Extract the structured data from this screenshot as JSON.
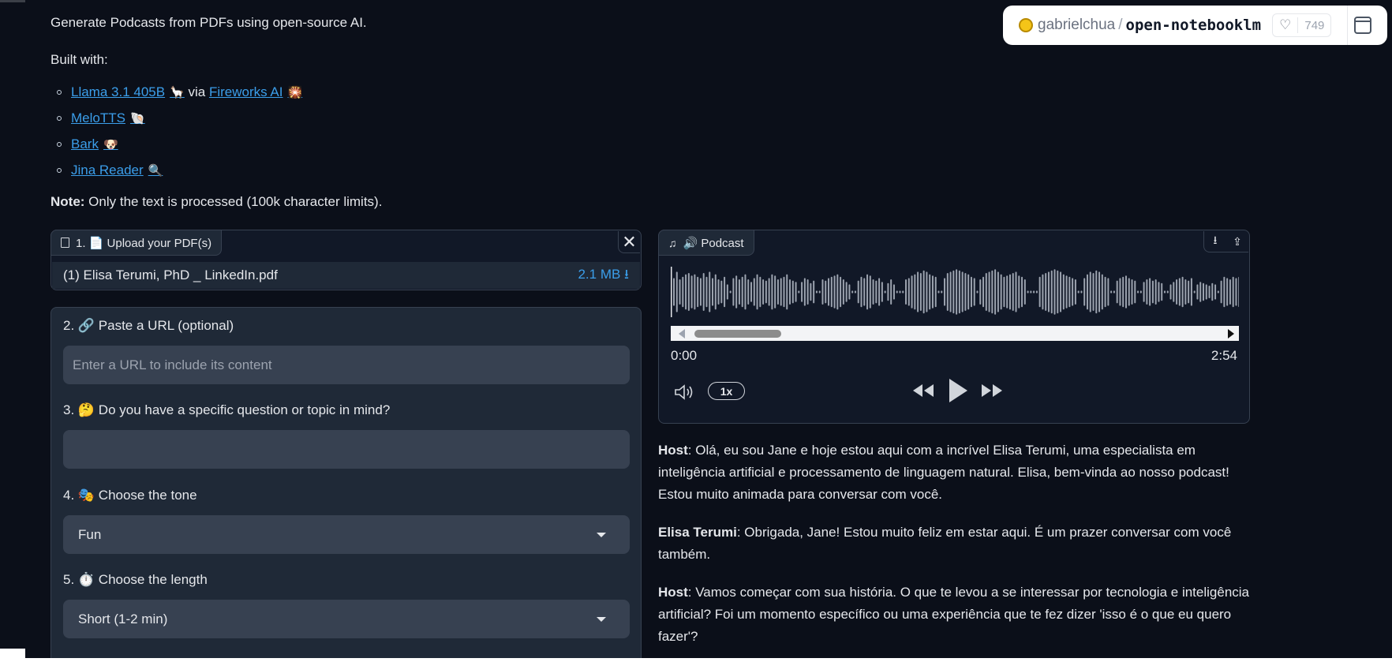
{
  "intro": {
    "tagline": "Generate Podcasts from PDFs using open-source AI.",
    "built_label": "Built with:",
    "links": [
      {
        "label": "Llama 3.1 405B",
        "emoji": "🦙",
        "via": " via ",
        "label2": "Fireworks AI",
        "emoji2": "🎇"
      },
      {
        "label": "MeloTTS",
        "emoji": "🐚"
      },
      {
        "label": "Bark",
        "emoji": "🐶"
      },
      {
        "label": "Jina Reader",
        "emoji": "🔍"
      }
    ],
    "note_bold": "Note:",
    "note_text": " Only the text is processed (100k character limits)."
  },
  "badge": {
    "owner": "gabrielchua",
    "slash": "/",
    "repo": "open-notebooklm",
    "likes": "749",
    "heart": "♡"
  },
  "upload": {
    "tab_label": "1. 📄 Upload your PDF(s)",
    "file_name": "(1) Elisa Terumi, PhD _ LinkedIn.pdf",
    "file_size": "2.1 MB ⭳",
    "close": "✕"
  },
  "form": {
    "url_label": "2. 🔗  Paste a URL (optional)",
    "url_placeholder": "Enter a URL to include its content",
    "question_label": "3. 🤔  Do you have a specific question or topic in mind?",
    "question_value": "",
    "tone_label": "4. 🎭  Choose the tone",
    "tone_value": "Fun",
    "length_label": "5. ⏱️  Choose the length",
    "length_value": "Short (1-2 min)"
  },
  "audio": {
    "tab_label": "🔊 Podcast",
    "time_current": "0:00",
    "time_total": "2:54",
    "speed": "1x",
    "download_icon": "⭳",
    "share_icon": "⇪"
  },
  "transcript": [
    {
      "speaker": "Host",
      "text": ": Olá, eu sou Jane e hoje estou aqui com a incrível Elisa Terumi, uma especialista em inteligência artificial e processamento de linguagem natural. Elisa, bem-vinda ao nosso podcast! Estou muito animada para conversar com você."
    },
    {
      "speaker": "Elisa Terumi",
      "text": ": Obrigada, Jane! Estou muito feliz em estar aqui. É um prazer conversar com você também."
    },
    {
      "speaker": "Host",
      "text": ": Vamos começar com sua história. O que te levou a se interessar por tecnologia e inteligência artificial? Foi um momento específico ou uma experiência que te fez dizer 'isso é o que eu quero fazer'?"
    }
  ],
  "waveform_levels": [
    0.55,
    0.8,
    0.5,
    0.6,
    0.7,
    0.75,
    0.65,
    0.7,
    0.6,
    0.55,
    0.75,
    0.6,
    0.8,
    0.55,
    0.7,
    0.5,
    0.45,
    0.6,
    0.3,
    0.05,
    0.55,
    0.65,
    0.5,
    0.6,
    0.7,
    0.5,
    0.4,
    0.55,
    0.7,
    0.6,
    0.5,
    0.45,
    0.55,
    0.7,
    0.65,
    0.5,
    0.55,
    0.6,
    0.7,
    0.5,
    0.45,
    0.4,
    0.05,
    0.4,
    0.55,
    0.5,
    0.35,
    0.45,
    0.05,
    0.05,
    0.5,
    0.45,
    0.55,
    0.6,
    0.65,
    0.7,
    0.6,
    0.5,
    0.4,
    0.3,
    0.05,
    0.05,
    0.45,
    0.6,
    0.55,
    0.7,
    0.65,
    0.5,
    0.45,
    0.55,
    0.4,
    0.05,
    0.35,
    0.5,
    0.3,
    0.05,
    0.05,
    0.05,
    0.5,
    0.55,
    0.65,
    0.7,
    0.8,
    0.75,
    0.85,
    0.8,
    0.7,
    0.65,
    0.6,
    0.05,
    0.05,
    0.55,
    0.75,
    0.8,
    0.85,
    0.9,
    0.85,
    0.8,
    0.75,
    0.7,
    0.6,
    0.55,
    0.05,
    0.5,
    0.6,
    0.75,
    0.8,
    0.85,
    0.9,
    0.8,
    0.7,
    0.6,
    0.65,
    0.7,
    0.75,
    0.8,
    0.65,
    0.6,
    0.5,
    0.05,
    0.05,
    0.05,
    0.05,
    0.6,
    0.7,
    0.75,
    0.8,
    0.85,
    0.9,
    0.85,
    0.8,
    0.7,
    0.65,
    0.6,
    0.55,
    0.5,
    0.05,
    0.05,
    0.55,
    0.7,
    0.8,
    0.75,
    0.85,
    0.8,
    0.7,
    0.6,
    0.55,
    0.05,
    0.05,
    0.45,
    0.55,
    0.6,
    0.65,
    0.55,
    0.5,
    0.45,
    0.05,
    0.05,
    0.4,
    0.5,
    0.55,
    0.45,
    0.5,
    0.4,
    0.35,
    0.05,
    0.05,
    0.3,
    0.4,
    0.5,
    0.55,
    0.6,
    0.5,
    0.45,
    0.55,
    0.05,
    0.3,
    0.4,
    0.35,
    0.3,
    0.25,
    0.35,
    0.3,
    0.05,
    0.45,
    0.6,
    0.55,
    0.5,
    0.6,
    0.55,
    0.6
  ]
}
